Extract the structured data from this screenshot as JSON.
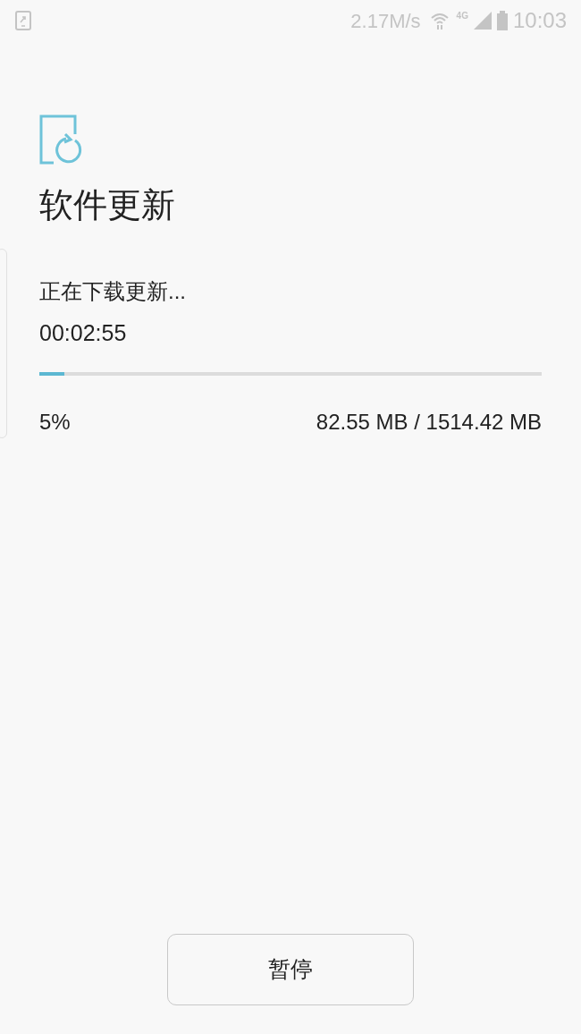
{
  "status_bar": {
    "speed": "2.17M/s",
    "network": "4G",
    "time": "10:03"
  },
  "title": "软件更新",
  "download": {
    "status": "正在下载更新...",
    "elapsed": "00:02:55",
    "level": 0.05,
    "percent": "5%",
    "size": "82.55 MB / 1514.42 MB"
  },
  "buttons": [
    "暂停"
  ]
}
